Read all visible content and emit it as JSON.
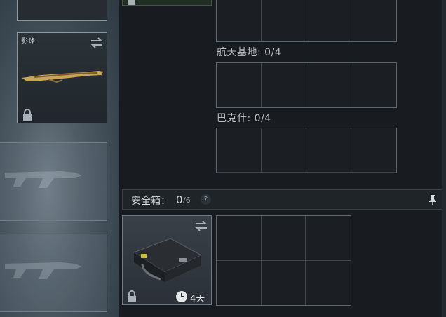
{
  "left_column": {
    "weapon_card": {
      "name": "影锋",
      "icons": [
        "swap-icon",
        "lock-icon"
      ]
    }
  },
  "storage_sections": [
    {
      "label": "航天基地: 0/4"
    },
    {
      "label": "巴克什: 0/4"
    }
  ],
  "safe_box": {
    "label": "安全箱：",
    "count": "0",
    "capacity": "/6",
    "help": "?",
    "duration": "4天",
    "icons": [
      "swap-icon",
      "lock-icon",
      "clock-icon",
      "pin-icon",
      "help-icon"
    ]
  },
  "colors": {
    "panel": "#181c20",
    "border": "#5c666d",
    "text": "#b9bfc4"
  }
}
